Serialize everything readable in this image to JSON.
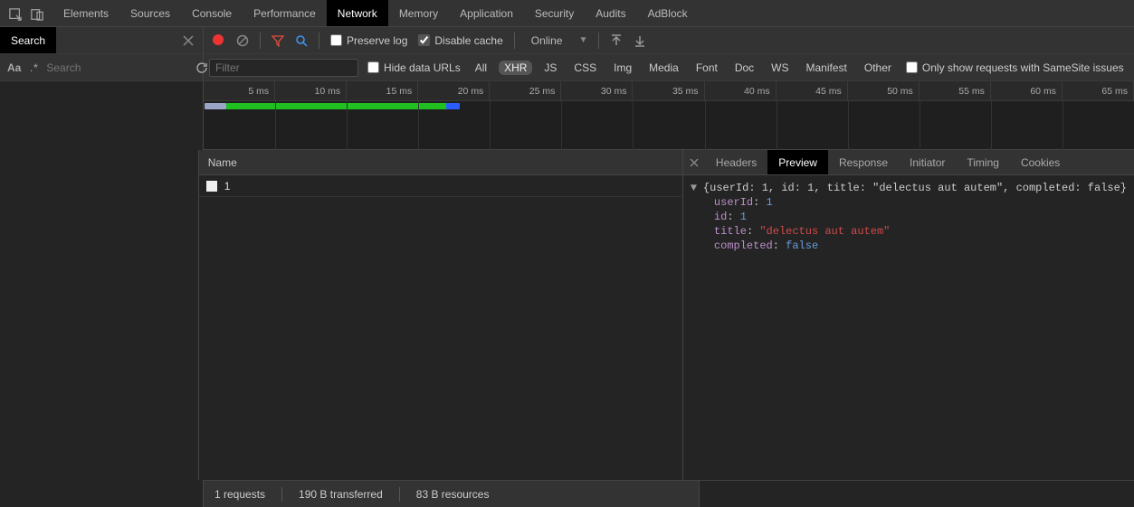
{
  "mainTabs": {
    "items": [
      "Elements",
      "Sources",
      "Console",
      "Performance",
      "Network",
      "Memory",
      "Application",
      "Security",
      "Audits",
      "AdBlock"
    ],
    "active": "Network"
  },
  "searchPane": {
    "title": "Search",
    "placeholder": "Search"
  },
  "toolbar": {
    "preserve": {
      "label": "Preserve log",
      "checked": false
    },
    "disableCache": {
      "label": "Disable cache",
      "checked": true
    },
    "throttle": "Online"
  },
  "filterBar": {
    "placeholder": "Filter",
    "hideDataUrls": {
      "label": "Hide data URLs",
      "checked": false
    },
    "types": [
      "All",
      "XHR",
      "JS",
      "CSS",
      "Img",
      "Media",
      "Font",
      "Doc",
      "WS",
      "Manifest",
      "Other"
    ],
    "activeType": "XHR",
    "sameSite": {
      "label": "Only show requests with SameSite issues",
      "checked": false
    }
  },
  "waterfall": {
    "ticks": [
      "5 ms",
      "10 ms",
      "15 ms",
      "20 ms",
      "25 ms",
      "30 ms",
      "35 ms",
      "40 ms",
      "45 ms",
      "50 ms",
      "55 ms",
      "60 ms",
      "65 ms"
    ]
  },
  "requests": {
    "columnHeader": "Name",
    "rows": [
      {
        "name": "1"
      }
    ]
  },
  "detailTabs": {
    "items": [
      "Headers",
      "Preview",
      "Response",
      "Initiator",
      "Timing",
      "Cookies"
    ],
    "active": "Preview"
  },
  "preview": {
    "summary": "{userId: 1, id: 1, title: \"delectus aut autem\", completed: false}",
    "props": [
      {
        "key": "userId",
        "value": "1",
        "type": "num"
      },
      {
        "key": "id",
        "value": "1",
        "type": "num"
      },
      {
        "key": "title",
        "value": "\"delectus aut autem\"",
        "type": "str"
      },
      {
        "key": "completed",
        "value": "false",
        "type": "bool"
      }
    ]
  },
  "statusBar": {
    "requests": "1 requests",
    "transferred": "190 B transferred",
    "resources": "83 B resources"
  }
}
